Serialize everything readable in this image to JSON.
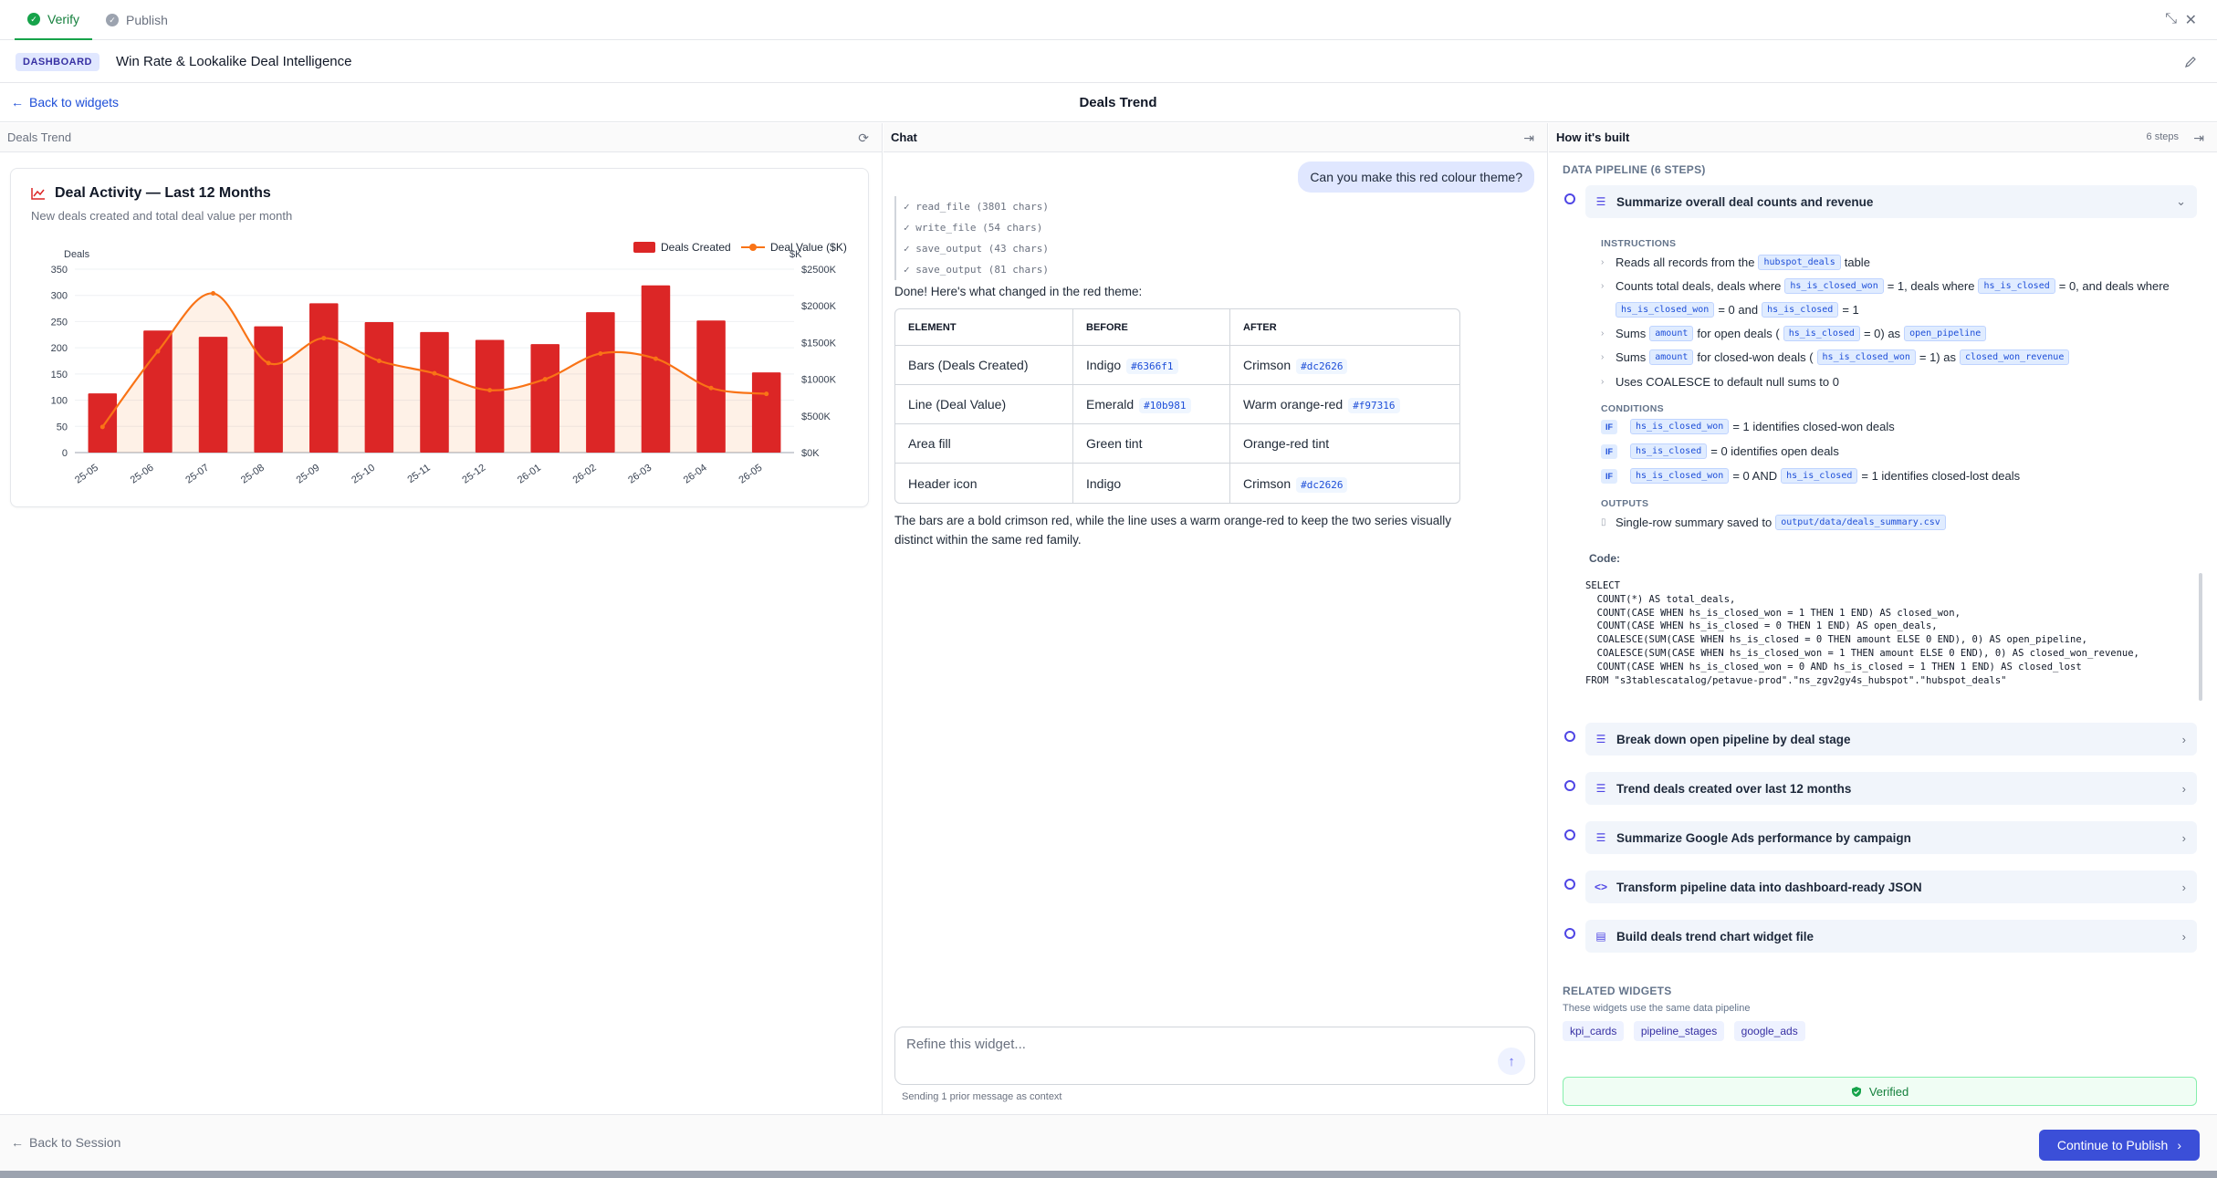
{
  "tabs": [
    {
      "label": "Verify",
      "active": true
    },
    {
      "label": "Publish",
      "active": false
    }
  ],
  "dashboard": {
    "badge": "DASHBOARD",
    "title": "Win Rate & Lookalike Deal Intelligence"
  },
  "widget_bar": {
    "back_label": "Back to widgets",
    "title": "Deals Trend"
  },
  "left_panel": {
    "header": "Deals Trend"
  },
  "chart_card": {
    "title": "Deal Activity — Last 12 Months",
    "subtitle": "New deals created and total deal value per month"
  },
  "chart_data": {
    "type": "bar",
    "categories": [
      "25-05",
      "25-06",
      "25-07",
      "25-08",
      "25-09",
      "25-10",
      "25-11",
      "25-12",
      "26-01",
      "26-02",
      "26-03",
      "26-04",
      "26-05"
    ],
    "series": [
      {
        "name": "Deals Created",
        "type": "bar",
        "axis": "left",
        "color": "#dc2626",
        "values": [
          113,
          233,
          221,
          241,
          285,
          249,
          230,
          215,
          207,
          268,
          319,
          252,
          153
        ]
      },
      {
        "name": "Deal Value ($K)",
        "type": "line",
        "axis": "right",
        "color": "#f97316",
        "values": [
          350,
          1380,
          2170,
          1220,
          1560,
          1250,
          1080,
          850,
          1000,
          1350,
          1280,
          880,
          800
        ]
      }
    ],
    "y_left": {
      "label": "Deals",
      "ticks": [
        "0",
        "50",
        "100",
        "150",
        "200",
        "250",
        "300",
        "350"
      ],
      "min": 0,
      "max": 350
    },
    "y_right": {
      "label": "$K",
      "ticks": [
        "$0K",
        "$500K",
        "$1000K",
        "$1500K",
        "$2000K",
        "$2500K"
      ],
      "min": 0,
      "max": 2500
    },
    "legend_position": "top-right",
    "grid": true
  },
  "chat": {
    "header": "Chat",
    "user_message": "Can you make this red colour theme?",
    "tool_calls": [
      "✓ read_file (3801 chars)",
      "✓ write_file (54 chars)",
      "✓ save_output (43 chars)",
      "✓ save_output (81 chars)"
    ],
    "intro": "Done! Here's what changed in the red theme:",
    "table": {
      "headers": [
        "ELEMENT",
        "BEFORE",
        "AFTER"
      ],
      "rows": [
        {
          "element": "Bars (Deals Created)",
          "before": "Indigo",
          "before_hex": "#6366f1",
          "after": "Crimson",
          "after_hex": "#dc2626"
        },
        {
          "element": "Line (Deal Value)",
          "before": "Emerald",
          "before_hex": "#10b981",
          "after": "Warm orange-red",
          "after_hex": "#f97316"
        },
        {
          "element": "Area fill",
          "before": "Green tint",
          "before_hex": "",
          "after": "Orange-red tint",
          "after_hex": ""
        },
        {
          "element": "Header icon",
          "before": "Indigo",
          "before_hex": "",
          "after": "Crimson",
          "after_hex": "#dc2626"
        }
      ]
    },
    "outro_1": "The bars are a bold crimson red, while the line uses a warm orange-red to keep the two series visually",
    "outro_2": "distinct within the same red family.",
    "input_placeholder": "Refine this widget...",
    "context_note": "Sending 1 prior message as context"
  },
  "how_built": {
    "header": "How it's built",
    "steps_count": "6 steps",
    "pipeline_label": "DATA PIPELINE (6 STEPS)",
    "expanded_step": {
      "title": "Summarize overall deal counts and revenue",
      "instructions_label": "INSTRUCTIONS",
      "conditions_label": "CONDITIONS",
      "outputs_label": "OUTPUTS",
      "code_label": "Code:",
      "instr": {
        "i1a": "Reads all records from the",
        "i1tag": "hubspot_deals",
        "i1b": "table",
        "i2a": "Counts total deals, deals where",
        "i2tag1": "hs_is_closed_won",
        "i2b": "= 1, deals where",
        "i2tag2": "hs_is_closed",
        "i2c": "= 0, and deals where",
        "i2tag3": "hs_is_closed_won",
        "i2d": "= 0 and",
        "i2tag4": "hs_is_closed",
        "i2e": "= 1",
        "i3a": "Sums",
        "i3tag1": "amount",
        "i3b": "for open deals (",
        "i3tag2": "hs_is_closed",
        "i3c": "= 0) as",
        "i3tag3": "open_pipeline",
        "i4a": "Sums",
        "i4tag1": "amount",
        "i4b": "for closed-won deals (",
        "i4tag2": "hs_is_closed_won",
        "i4c": "= 1) as",
        "i4tag3": "closed_won_revenue",
        "i5": "Uses COALESCE to default null sums to 0"
      },
      "cond": {
        "if": "IF",
        "c1tag": "hs_is_closed_won",
        "c1": "= 1 identifies closed-won deals",
        "c2tag": "hs_is_closed",
        "c2": "= 0 identifies open deals",
        "c3tag1": "hs_is_closed_won",
        "c3a": "= 0 AND",
        "c3tag2": "hs_is_closed",
        "c3b": "= 1 identifies closed-lost deals"
      },
      "output": {
        "text": "Single-row summary saved to",
        "tag": "output/data/deals_summary.csv"
      },
      "code": "SELECT\n  COUNT(*) AS total_deals,\n  COUNT(CASE WHEN hs_is_closed_won = 1 THEN 1 END) AS closed_won,\n  COUNT(CASE WHEN hs_is_closed = 0 THEN 1 END) AS open_deals,\n  COALESCE(SUM(CASE WHEN hs_is_closed = 0 THEN amount ELSE 0 END), 0) AS open_pipeline,\n  COALESCE(SUM(CASE WHEN hs_is_closed_won = 1 THEN amount ELSE 0 END), 0) AS closed_won_revenue,\n  COUNT(CASE WHEN hs_is_closed_won = 0 AND hs_is_closed = 1 THEN 1 END) AS closed_lost\nFROM \"s3tablescatalog/petavue-prod\".\"ns_zgv2gy4s_hubspot\".\"hubspot_deals\""
    },
    "collapsed_steps": [
      "Break down open pipeline by deal stage",
      "Trend deals created over last 12 months",
      "Summarize Google Ads performance by campaign",
      "Transform pipeline data into dashboard-ready JSON",
      "Build deals trend chart widget file"
    ],
    "related_label": "RELATED WIDGETS",
    "related_sub": "These widgets use the same data pipeline",
    "related": [
      "kpi_cards",
      "pipeline_stages",
      "google_ads"
    ],
    "verified_label": "Verified"
  },
  "footer": {
    "back_label": "Back to Session",
    "publish_label": "Continue to Publish"
  }
}
